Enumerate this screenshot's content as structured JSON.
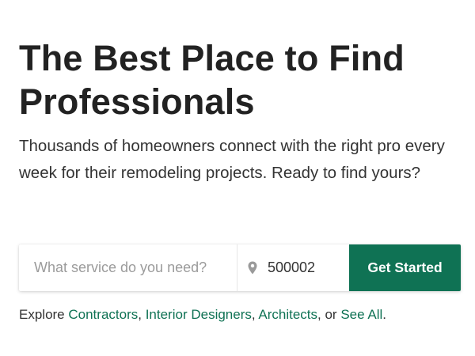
{
  "hero": {
    "title": "The Best Place to Find Professionals",
    "subtitle": "Thousands of homeowners connect with the right pro every week for their remodeling projects. Ready to find yours?"
  },
  "search": {
    "service_placeholder": "What service do you need?",
    "service_value": "",
    "location_value": "500002",
    "location_icon": "map-pin-icon",
    "submit_label": "Get Started"
  },
  "explore": {
    "prefix": "Explore ",
    "links": [
      "Contractors",
      "Interior Designers",
      "Architects",
      "See All"
    ],
    "sep1": ", ",
    "sep2": ", ",
    "sep3": ", or ",
    "suffix": "."
  },
  "colors": {
    "accent": "#0f7254",
    "text": "#222222",
    "placeholder": "#9b9b9b",
    "icon": "#9a9a9a"
  }
}
